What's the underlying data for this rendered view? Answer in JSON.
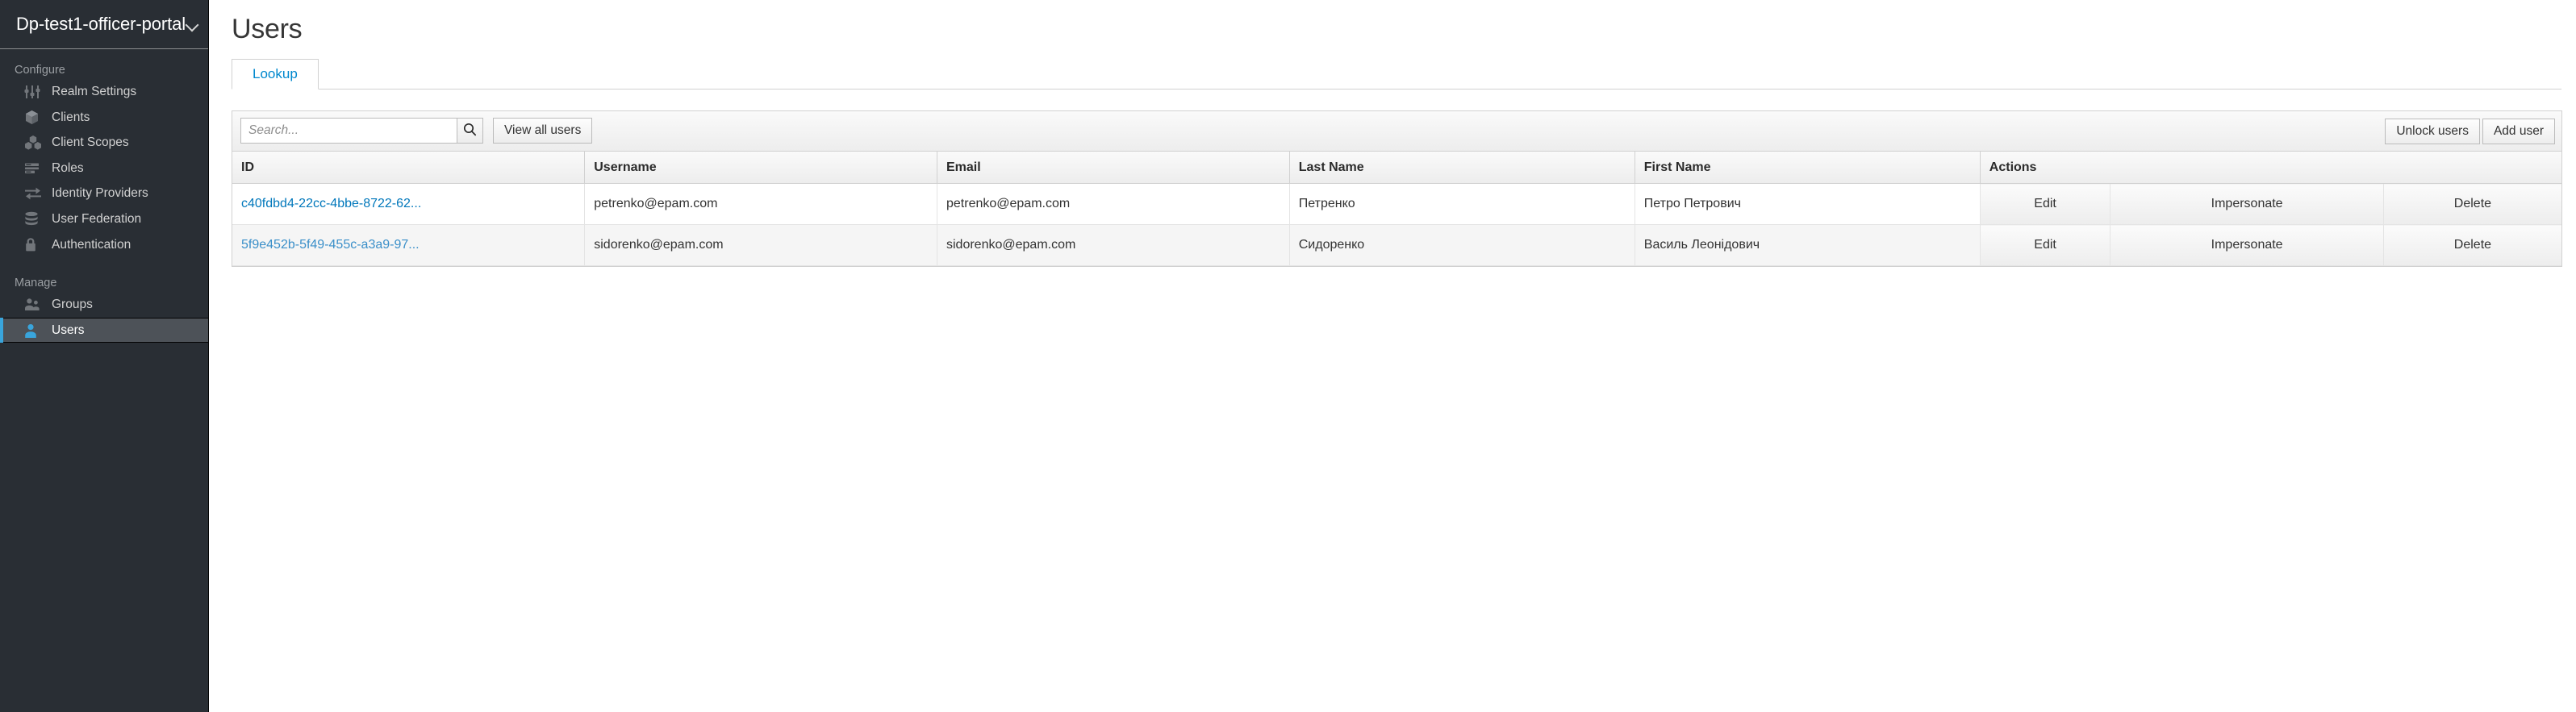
{
  "sidebar": {
    "realm": {
      "name": "Dp-test1-officer-portal",
      "chevron_icon": "chevron-down-icon"
    },
    "groups": [
      {
        "label": "Configure",
        "items": [
          {
            "label": "Realm Settings",
            "icon": "sliders-icon",
            "active": false
          },
          {
            "label": "Clients",
            "icon": "cube-icon",
            "active": false
          },
          {
            "label": "Client Scopes",
            "icon": "cubes-icon",
            "active": false
          },
          {
            "label": "Roles",
            "icon": "list-icon",
            "active": false
          },
          {
            "label": "Identity Providers",
            "icon": "exchange-arrows-icon",
            "active": false
          },
          {
            "label": "User Federation",
            "icon": "database-icon",
            "active": false
          },
          {
            "label": "Authentication",
            "icon": "lock-icon",
            "active": false
          }
        ]
      },
      {
        "label": "Manage",
        "items": [
          {
            "label": "Groups",
            "icon": "users-group-icon",
            "active": false
          },
          {
            "label": "Users",
            "icon": "user-icon",
            "active": true
          }
        ]
      }
    ]
  },
  "main": {
    "page_title": "Users",
    "tabs": [
      {
        "label": "Lookup",
        "active": true
      }
    ],
    "toolbar": {
      "search_placeholder": "Search...",
      "search_value": "",
      "search_icon": "search-icon",
      "view_all_label": "View all users",
      "unlock_users_label": "Unlock users",
      "add_user_label": "Add user"
    },
    "table": {
      "columns": [
        "ID",
        "Username",
        "Email",
        "Last Name",
        "First Name",
        "Actions"
      ],
      "rows": [
        {
          "id": "c40fdbd4-22cc-4bbe-8722-62...",
          "username": "petrenko@epam.com",
          "email": "petrenko@epam.com",
          "last_name": "Петренко",
          "first_name": "Петро Петрович",
          "actions": [
            "Edit",
            "Impersonate",
            "Delete"
          ]
        },
        {
          "id": "5f9e452b-5f49-455c-a3a9-97...",
          "username": "sidorenko@epam.com",
          "email": "sidorenko@epam.com",
          "last_name": "Сидоренко",
          "first_name": "Василь Леонідович",
          "actions": [
            "Edit",
            "Impersonate",
            "Delete"
          ]
        }
      ]
    }
  },
  "colors": {
    "sidebar_bg": "#292e34",
    "sidebar_active_bg": "#4d5258",
    "accent_blue": "#39a5dc",
    "link_blue": "#0077bb",
    "tab_blue": "#0088ce"
  }
}
